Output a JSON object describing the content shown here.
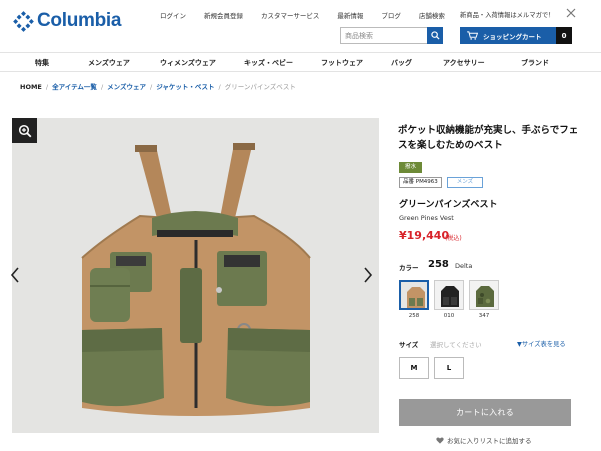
{
  "header": {
    "brand": "Columbia",
    "top_links": [
      "ログイン",
      "新規会員登録",
      "カスタマーサービス",
      "最新情報",
      "ブログ",
      "店舗検索"
    ],
    "notice": "新商品・入荷情報はメルマガで！",
    "search_placeholder": "商品検索",
    "cart_label": "ショッピングカート",
    "cart_count": "0",
    "brand_color": "#1a5ea8"
  },
  "nav": {
    "items": [
      "特集",
      "メンズウェア",
      "ウィメンズウェア",
      "キッズ・ベビー",
      "フットウェア",
      "バッグ",
      "アクセサリー",
      "ブランド"
    ]
  },
  "breadcrumb": {
    "home": "HOME",
    "links": [
      "全アイテム一覧",
      "メンズウェア",
      "ジャケット・ベスト"
    ],
    "current": "グリーンパインズベスト",
    "separator": "/"
  },
  "gallery": {
    "zoom_icon": "zoom-in-icon",
    "prev_icon": "chevron-left-icon",
    "next_icon": "chevron-right-icon"
  },
  "product": {
    "title": "ポケット収納機能が充実し、手ぶらでフェスを楽しむためのベスト",
    "feature_badge": "撥水",
    "sku": "品番 PM4963",
    "gender": "メンズ",
    "name": "グリーンパインズベスト",
    "name_en": "Green Pines Vest",
    "price": "¥19,440",
    "tax_note": "(税込)",
    "price_color": "#d8232a"
  },
  "color": {
    "label": "カラー",
    "selected_code": "258",
    "selected_name": "Delta",
    "swatches": [
      {
        "code": "258",
        "selected": true
      },
      {
        "code": "010",
        "selected": false
      },
      {
        "code": "347",
        "selected": false
      }
    ]
  },
  "size": {
    "label": "サイズ",
    "prompt": "選択してください",
    "chart_link": "▼サイズ表を見る",
    "options": [
      "M",
      "L"
    ]
  },
  "actions": {
    "add_to_cart": "カートに入れる",
    "wishlist": "お気に入りリストに追加する"
  }
}
